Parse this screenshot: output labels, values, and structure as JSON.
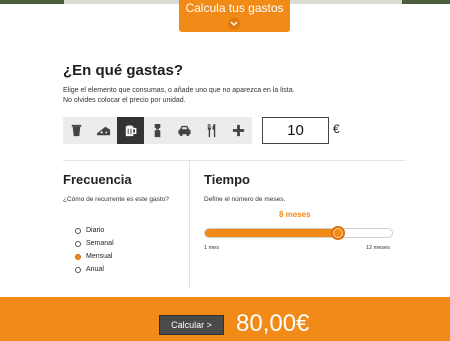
{
  "header": {
    "tab_label": "Calcula tus gastos",
    "toggle_icon": "chevron-down-icon"
  },
  "expenses": {
    "heading": "¿En qué gastas?",
    "description_line1": "Elige el elemento que consumas, o añade uno que no aparezca en la lista.",
    "description_line2": "No olvides colocar el precio por unidad.",
    "categories": [
      {
        "name": "coffee-cup",
        "icon": "coffee-cup-icon",
        "selected": false
      },
      {
        "name": "cheese",
        "icon": "cheese-icon",
        "selected": false
      },
      {
        "name": "beer-mug",
        "icon": "beer-mug-icon",
        "selected": true
      },
      {
        "name": "ticket",
        "icon": "ticket-icon",
        "selected": false
      },
      {
        "name": "car",
        "icon": "car-icon",
        "selected": false
      },
      {
        "name": "restaurant",
        "icon": "fork-knife-icon",
        "selected": false
      },
      {
        "name": "add",
        "icon": "plus-icon",
        "selected": false
      }
    ],
    "amount": "10",
    "currency": "€"
  },
  "frequency": {
    "title": "Frecuencia",
    "question": "¿Cómo de recurrente es este gasto?",
    "options": [
      "Diario",
      "Semanal",
      "Mensual",
      "Anual"
    ],
    "selected": "Mensual"
  },
  "time": {
    "title": "Tiempo",
    "instruction": "Define el número de meses.",
    "value_label": "8 meses",
    "min_label": "1 mes",
    "max_label": "12 meses",
    "value": 8,
    "min": 1,
    "max": 12
  },
  "footer": {
    "calculate_label": "Calcular >",
    "total": "80,00€"
  },
  "colors": {
    "accent": "#f28a17",
    "dark": "#333333"
  }
}
